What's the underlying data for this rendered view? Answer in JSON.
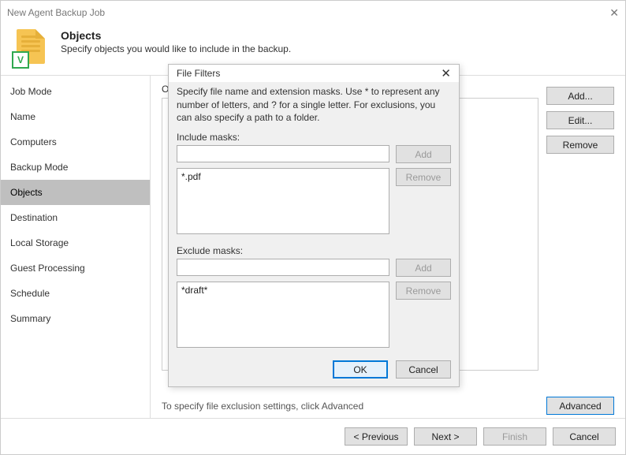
{
  "window": {
    "title": "New Agent Backup Job",
    "close_glyph": "✕"
  },
  "header": {
    "title": "Objects",
    "subtitle": "Specify objects you would like to include in the backup.",
    "badge_letter": "V"
  },
  "sidebar": {
    "steps": [
      "Job Mode",
      "Name",
      "Computers",
      "Backup Mode",
      "Objects",
      "Destination",
      "Local Storage",
      "Guest Processing",
      "Schedule",
      "Summary"
    ],
    "selected_index": 4
  },
  "main": {
    "objects_label_partial": "O",
    "hint": "To specify file exclusion settings, click Advanced",
    "buttons": {
      "add": "Add...",
      "edit": "Edit...",
      "remove": "Remove",
      "advanced": "Advanced"
    }
  },
  "footer": {
    "previous": "< Previous",
    "next": "Next >",
    "finish": "Finish",
    "cancel": "Cancel"
  },
  "modal": {
    "title": "File Filters",
    "close_glyph": "✕",
    "description": "Specify file name and extension masks. Use * to represent any number of letters, and ? for a single letter. For exclusions, you can also specify a path to a folder.",
    "include": {
      "label": "Include masks:",
      "input_value": "",
      "add": "Add",
      "remove": "Remove",
      "items": [
        "*.pdf"
      ]
    },
    "exclude": {
      "label": "Exclude masks:",
      "input_value": "",
      "add": "Add",
      "remove": "Remove",
      "items": [
        "*draft*"
      ]
    },
    "ok": "OK",
    "cancel": "Cancel"
  }
}
